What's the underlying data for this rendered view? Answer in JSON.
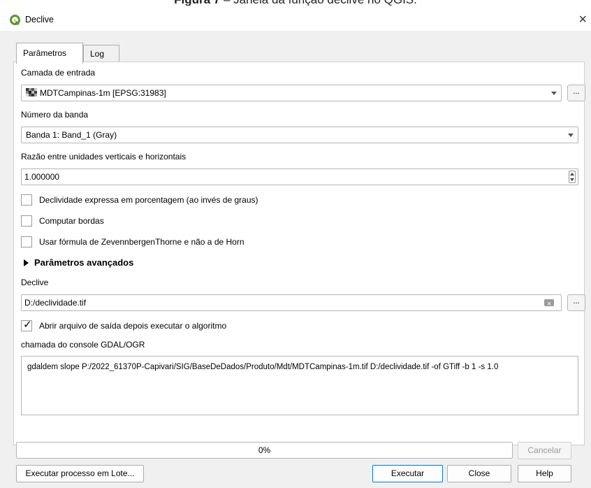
{
  "caption": {
    "prefix": "Figura 7",
    "text": " – Janela da função declive no QGIS."
  },
  "window": {
    "title": "Declive",
    "close_glyph": "×"
  },
  "tabs": [
    {
      "label": "Parâmetros",
      "active": true
    },
    {
      "label": "Log",
      "active": false
    }
  ],
  "params": {
    "input_layer_label": "Camada de entrada",
    "input_layer_value": "MDTCampinas-1m [EPSG:31983]",
    "dots_label": "...",
    "band_label": "Número da banda",
    "band_value": "Banda 1: Band_1 (Gray)",
    "ratio_label": "Razão entre unidades verticais e horizontais",
    "ratio_value": "1.000000",
    "checkbox_percent": {
      "label": "Declividade expressa em porcentagem (ao invés de graus)",
      "checked": false
    },
    "checkbox_edges": {
      "label": "Computar bordas",
      "checked": false
    },
    "checkbox_zevenbergen": {
      "label": "Usar fórmula de ZevennbergenThorne e não a de Horn",
      "checked": false
    },
    "advanced_label": "Parâmetros avançados",
    "output_label": "Declive",
    "output_value": "D:/declividade.tif",
    "checkbox_open": {
      "label": "Abrir arquivo de saída depois executar o algoritmo",
      "checked": true
    },
    "console_label": "chamada do console GDAL/OGR",
    "console_text": "gdaldem slope P:/2022_61370P-Capivari/SIG/BaseDeDados/Produto/Mdt/MDTCampinas-1m.tif D:/declividade.tif -of GTiff -b 1 -s 1.0"
  },
  "progress": {
    "value": 0,
    "text": "0%"
  },
  "buttons": {
    "cancel": "Cancelar",
    "batch": "Executar processo em Lote...",
    "run": "Executar",
    "close": "Close",
    "help": "Help"
  },
  "colors": {
    "qgis_green": "#589632",
    "accent_blue": "#0078d7"
  }
}
